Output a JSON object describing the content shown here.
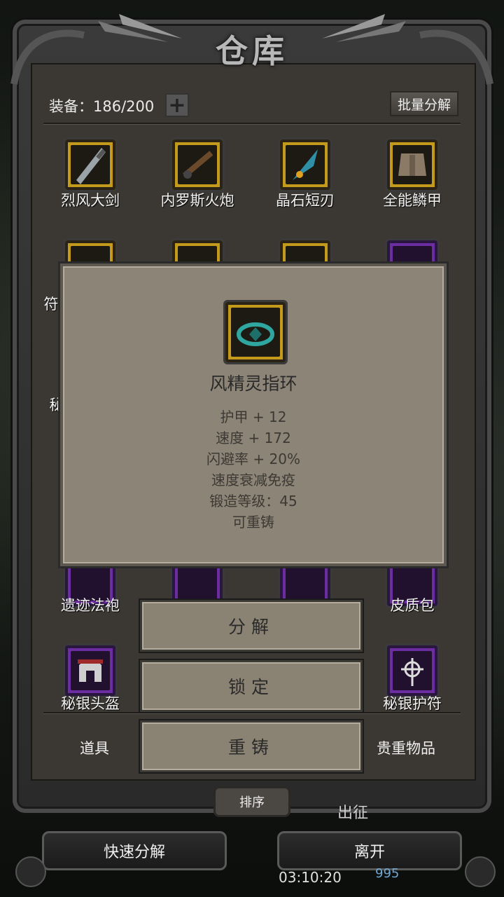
{
  "header": {
    "title": "仓库",
    "equip_label": "装备：186/200",
    "bulk_decompose_label": "批量分解"
  },
  "items": [
    {
      "name": "烈风大剑",
      "rarity": "gold",
      "icon": "greatsword-icon"
    },
    {
      "name": "内罗斯火炮",
      "rarity": "gold",
      "icon": "cannon-icon"
    },
    {
      "name": "晶石短刃",
      "rarity": "gold",
      "icon": "crystal-dagger-icon"
    },
    {
      "name": "全能鳞甲",
      "rarity": "gold",
      "icon": "scale-armor-icon"
    },
    {
      "name": "符",
      "rarity": "gold",
      "icon": "pauldron-icon"
    },
    {
      "name": "秘",
      "rarity": "gold",
      "icon": "item-icon"
    },
    {
      "name": "遗迹法袍",
      "rarity": "purple",
      "icon": "robe-icon"
    },
    {
      "name": "皮质包",
      "rarity": "purple",
      "icon": "leather-bag-icon"
    },
    {
      "name": "秘银头盔",
      "rarity": "purple",
      "icon": "helmet-icon"
    },
    {
      "name": "秘银护符",
      "rarity": "purple",
      "icon": "amulet-icon"
    }
  ],
  "tooltip": {
    "name": "风精灵指环",
    "icon": "ring-icon",
    "stats": [
      "护甲 + 12",
      "速度 + 172",
      "闪避率 + 20%",
      "速度衰减免疫",
      "锻造等级：45",
      "可重铸"
    ]
  },
  "actions": {
    "decompose": "分解",
    "lock": "锁定",
    "reforge": "重铸"
  },
  "tabs": {
    "props": "道具",
    "valuables": "贵重物品"
  },
  "sort_label": "排序",
  "bottom": {
    "quick_decompose": "快速分解",
    "leave": "离开",
    "expedition": "出征",
    "timer": "03:10:20",
    "gems": "995"
  },
  "colors": {
    "gold_frame": "#c49a1c",
    "purple_frame": "#6b2da0",
    "parchment": "#8c8476"
  }
}
